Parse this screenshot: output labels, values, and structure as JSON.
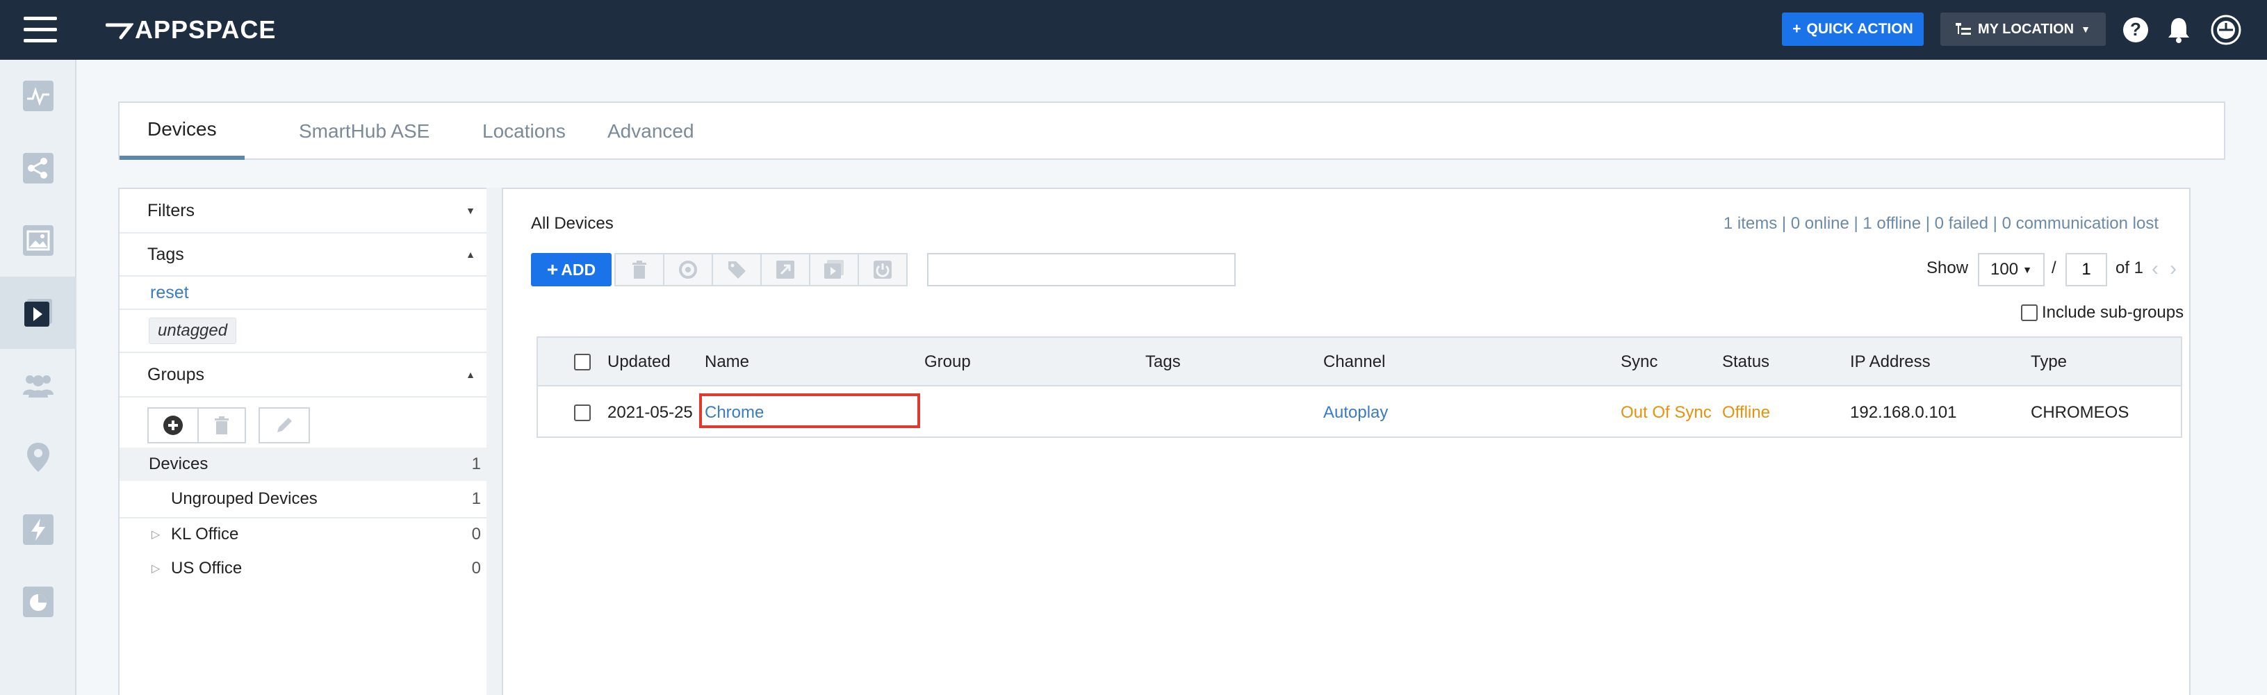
{
  "app": {
    "logo_text": "APPSPACE"
  },
  "header": {
    "quick_action_label": "QUICK ACTION",
    "my_location_label": "MY LOCATION",
    "icons": [
      "help-icon",
      "bell-icon",
      "profile-icon"
    ]
  },
  "rail": {
    "items": [
      "activity-icon",
      "share-icon",
      "image-icon",
      "player-icon",
      "users-icon",
      "location-icon",
      "lightning-icon",
      "pie-icon"
    ],
    "active": "player-icon"
  },
  "tabs": [
    {
      "label": "Devices",
      "active": true
    },
    {
      "label": "SmartHub ASE",
      "active": false
    },
    {
      "label": "Locations",
      "active": false
    },
    {
      "label": "Advanced",
      "active": false
    }
  ],
  "sidebar": {
    "filters_label": "Filters",
    "tags_label": "Tags",
    "reset_label": "reset",
    "untagged_label": "untagged",
    "groups_label": "Groups",
    "groups": [
      {
        "label": "Devices",
        "count": "1"
      },
      {
        "label": "Ungrouped Devices",
        "count": "1"
      },
      {
        "label": "KL Office",
        "count": "0"
      },
      {
        "label": "US Office",
        "count": "0"
      }
    ]
  },
  "main": {
    "title": "All Devices",
    "stats": "1 items | 0 online | 1 offline | 0 failed | 0 communication lost",
    "add_label": "ADD",
    "search_value": "",
    "show_label": "Show",
    "page_size": "100",
    "slash": "/",
    "page_value": "1",
    "of_label": "of 1",
    "include_subgroups_label": "Include sub-groups",
    "columns": {
      "updated": "Updated",
      "name": "Name",
      "group": "Group",
      "tags": "Tags",
      "channel": "Channel",
      "sync": "Sync",
      "status": "Status",
      "ip": "IP Address",
      "type": "Type"
    },
    "rows": [
      {
        "updated": "2021-05-25",
        "name": "Chrome",
        "group": "",
        "tags": "",
        "channel": "Autoplay",
        "sync": "Out Of Sync",
        "status": "Offline",
        "ip": "192.168.0.101",
        "type": "CHROMEOS"
      }
    ]
  },
  "colors": {
    "topbar": "#1e2d40",
    "primary": "#1a73e8",
    "link": "#3a7cc3",
    "warning": "#e8910c",
    "highlight": "#e03a2e"
  }
}
